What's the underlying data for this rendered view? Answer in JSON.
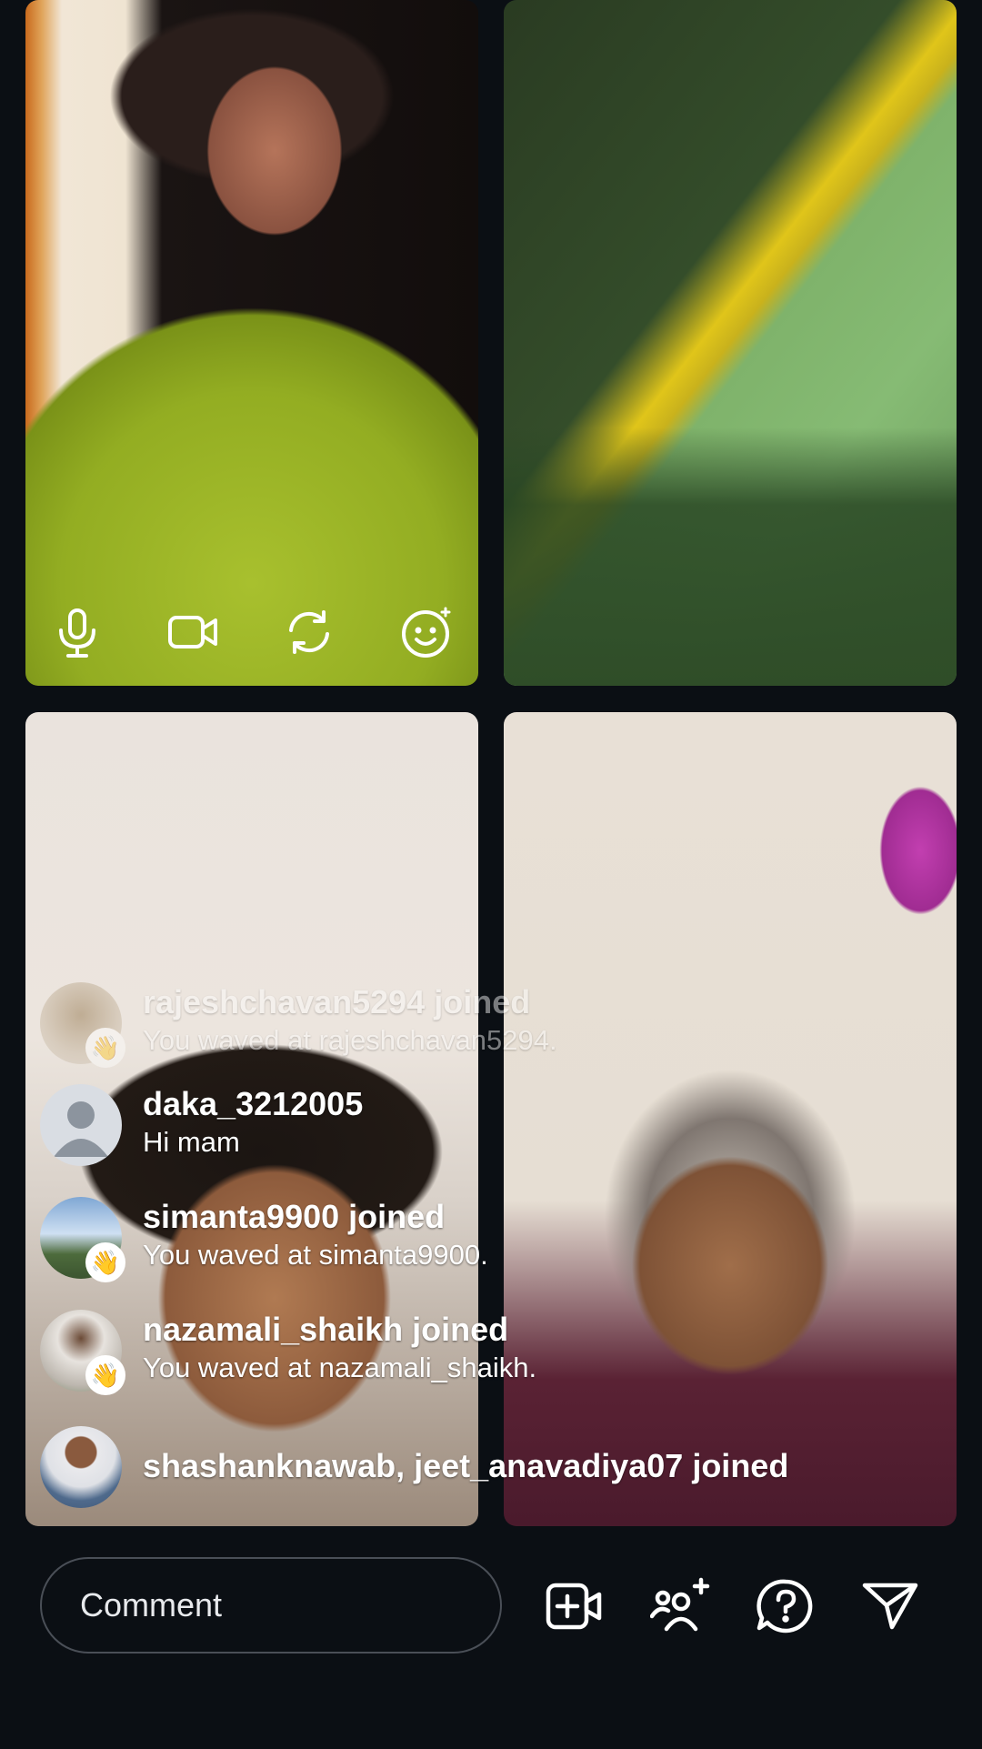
{
  "video_tiles": [
    {
      "id": "host"
    },
    {
      "id": "guest-2"
    },
    {
      "id": "guest-3"
    },
    {
      "id": "guest-4"
    }
  ],
  "host_controls": {
    "icons": [
      "microphone-icon",
      "video-camera-icon",
      "switch-camera-icon",
      "effects-face-icon"
    ]
  },
  "activity_feed": [
    {
      "username": "rajeshchavan5294 joined",
      "message": "You waved at rajeshchavan5294.",
      "waved": true,
      "faded": true
    },
    {
      "username": "daka_3212005",
      "message": "Hi mam",
      "waved": false,
      "faded": false
    },
    {
      "username": "simanta9900 joined",
      "message": "You waved at simanta9900.",
      "waved": true,
      "faded": false
    },
    {
      "username": "nazamali_shaikh joined",
      "message": "You waved at nazamali_shaikh.",
      "waved": true,
      "faded": false
    },
    {
      "username": "shashanknawab, jeet_anavadiya07 joined",
      "message": "",
      "waved": false,
      "faded": false
    }
  ],
  "bottom_bar": {
    "comment_placeholder": "Comment",
    "icons": [
      "add-video-icon",
      "invite-people-icon",
      "question-icon",
      "send-icon"
    ]
  }
}
